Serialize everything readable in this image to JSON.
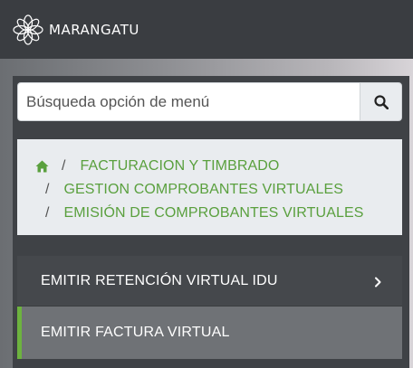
{
  "header": {
    "brand": "MARANGATU",
    "logo_icon": "mandala-logo-icon"
  },
  "search": {
    "placeholder": "Búsqueda opción de menú",
    "button_icon": "search-icon"
  },
  "breadcrumb": {
    "home_icon": "home-icon",
    "items": [
      "FACTURACION Y TIMBRADO",
      "GESTION COMPROBANTES VIRTUALES",
      "EMISIÓN DE COMPROBANTES VIRTUALES"
    ],
    "separator": "/"
  },
  "menu": {
    "items": [
      {
        "label": "EMITIR RETENCIÓN VIRTUAL IDU",
        "icon": "chevron-right-icon",
        "active": false
      },
      {
        "label": "EMITIR FACTURA VIRTUAL",
        "active": true
      }
    ]
  },
  "colors": {
    "topbar": "#3a3d41",
    "accent_green": "#5aa03e",
    "active_marker": "#6db33f"
  }
}
